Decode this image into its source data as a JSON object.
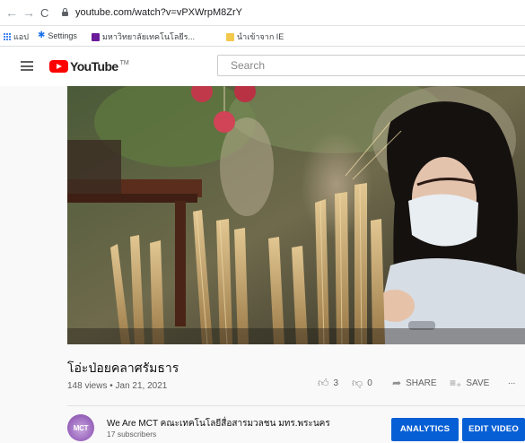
{
  "browser": {
    "url": "youtube.com/watch?v=vPXWrpM8ZrY",
    "bookmarks": [
      {
        "label": "แอป",
        "icon": "apps-grid-icon"
      },
      {
        "label": "Settings",
        "icon": "gear-icon",
        "color": "#1a73e8"
      },
      {
        "label": "มหาวิทยาลัยเทคโนโลยีร...",
        "icon": "bookmark-icon",
        "color": "#6a1b9a"
      },
      {
        "label": "นำเข้าจาก IE",
        "icon": "folder-icon",
        "color": "#f2c94c"
      }
    ]
  },
  "header": {
    "logo_text": "YouTube",
    "logo_tm": "TM",
    "search_placeholder": "Search",
    "brand_color": "#ff0000"
  },
  "video": {
    "title": "โอ่ะป่อยคลาศรัมธาร",
    "views": "148 views",
    "date": "Jan 21, 2021",
    "likes": "3",
    "dislikes": "0",
    "share_label": "SHARE",
    "save_label": "SAVE",
    "more_label": "..."
  },
  "channel": {
    "avatar_text": "MCT",
    "name": "We Are MCT คณะเทคโนโลยีสื่อสารมวลชน มทร.พระนคร",
    "subscribers": "17 subscribers",
    "analytics_label": "ANALYTICS",
    "edit_label": "EDIT VIDEO",
    "button_color": "#065fd4"
  }
}
